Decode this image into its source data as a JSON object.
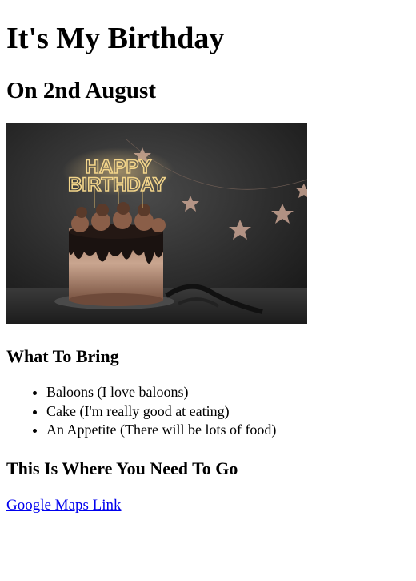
{
  "page": {
    "title": "It's My Birthday",
    "date_heading": "On 2nd August",
    "image": {
      "description_icon": "birthday-cake-image",
      "topper_text_line1": "HAPPY",
      "topper_text_line2": "BIRTHDAY"
    },
    "bring_section": {
      "heading": "What To Bring",
      "items": [
        "Baloons (I love baloons)",
        "Cake (I'm really good at eating)",
        "An Appetite (There will be lots of food)"
      ]
    },
    "location_section": {
      "heading": "This Is Where You Need To Go",
      "link_text": "Google Maps Link"
    },
    "colors": {
      "link": "#0000ee",
      "text": "#000000",
      "background": "#ffffff"
    }
  }
}
